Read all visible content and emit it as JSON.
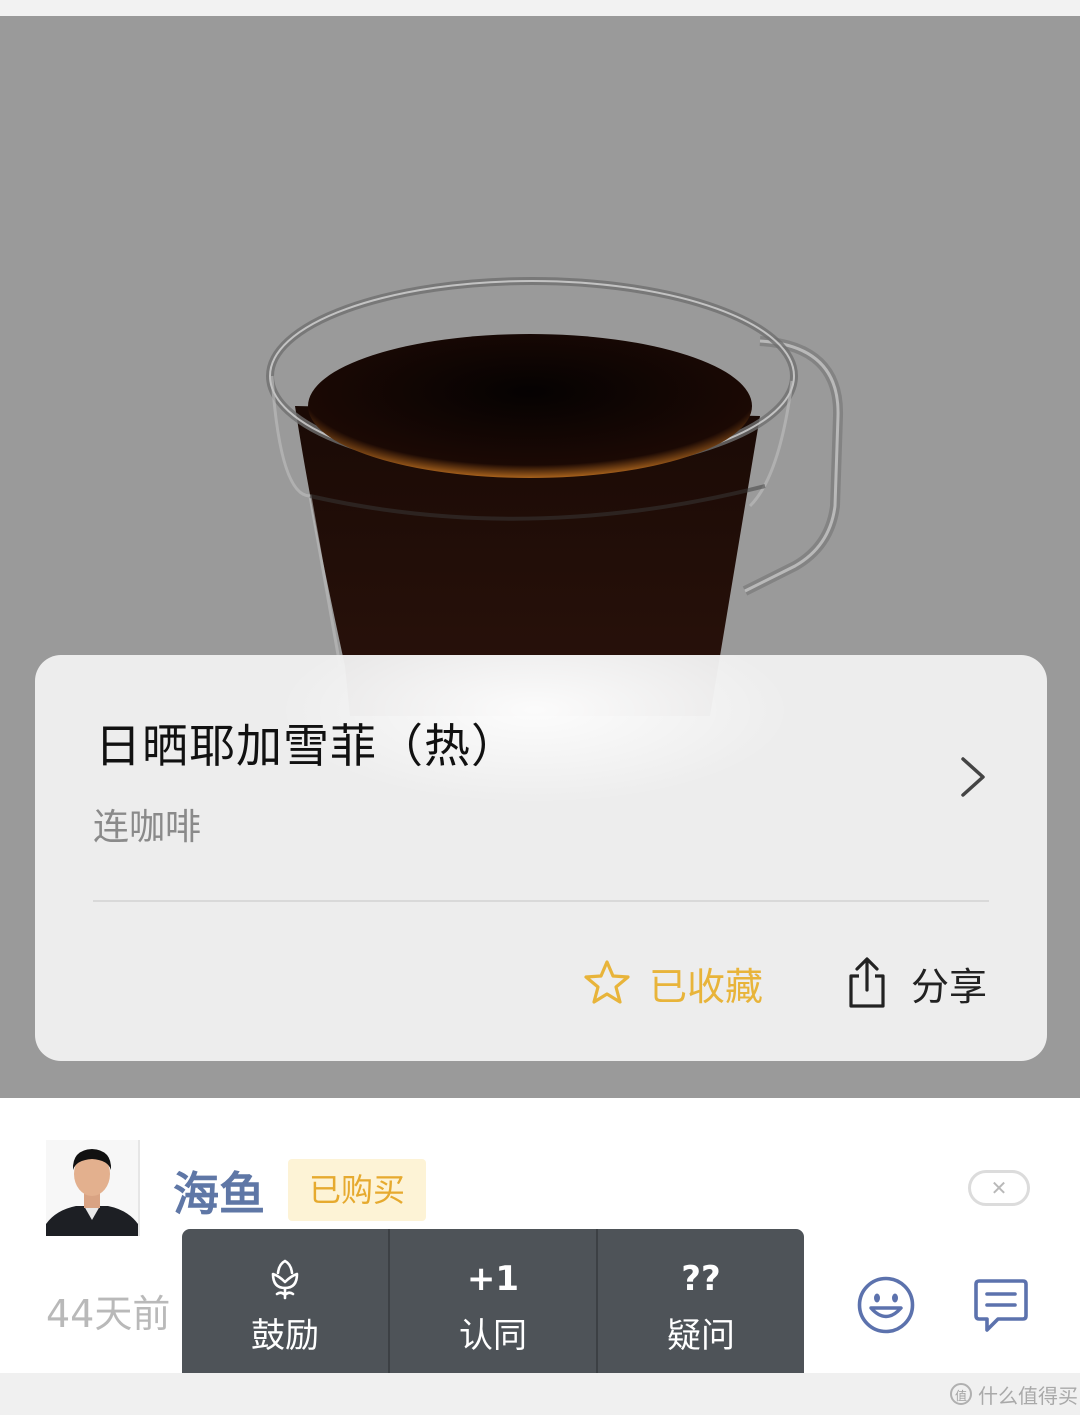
{
  "product_card": {
    "title": "日晒耶加雪菲（热）",
    "subtitle": "连咖啡",
    "favorite_label": "已收藏",
    "share_label": "分享"
  },
  "comment": {
    "username": "海鱼",
    "purchase_badge": "已购买",
    "time": "44天前"
  },
  "reaction_popup": {
    "items": [
      {
        "icon_text": "",
        "label": "鼓励",
        "icon": "flower-icon"
      },
      {
        "icon_text": "+1",
        "label": "认同",
        "icon": "plus-one-icon"
      },
      {
        "icon_text": "??",
        "label": "疑问",
        "icon": "question-icon"
      }
    ]
  },
  "watermark": {
    "text": "什么值得买",
    "logo_text": "值"
  },
  "colors": {
    "accent_gold": "#e8b43a",
    "username_blue": "#5f77a6",
    "popup_bg": "#4e5358",
    "icon_blue": "#5c72ad"
  }
}
